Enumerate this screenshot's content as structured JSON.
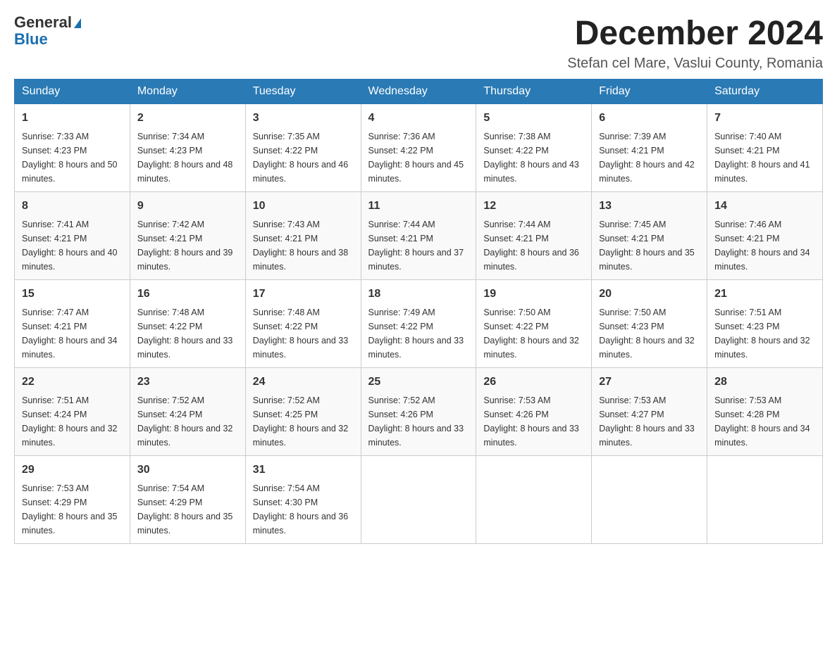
{
  "header": {
    "logo_general": "General",
    "logo_blue": "Blue",
    "month_year": "December 2024",
    "location": "Stefan cel Mare, Vaslui County, Romania"
  },
  "days_of_week": [
    "Sunday",
    "Monday",
    "Tuesday",
    "Wednesday",
    "Thursday",
    "Friday",
    "Saturday"
  ],
  "weeks": [
    [
      {
        "day": "1",
        "sunrise": "7:33 AM",
        "sunset": "4:23 PM",
        "daylight": "8 hours and 50 minutes."
      },
      {
        "day": "2",
        "sunrise": "7:34 AM",
        "sunset": "4:23 PM",
        "daylight": "8 hours and 48 minutes."
      },
      {
        "day": "3",
        "sunrise": "7:35 AM",
        "sunset": "4:22 PM",
        "daylight": "8 hours and 46 minutes."
      },
      {
        "day": "4",
        "sunrise": "7:36 AM",
        "sunset": "4:22 PM",
        "daylight": "8 hours and 45 minutes."
      },
      {
        "day": "5",
        "sunrise": "7:38 AM",
        "sunset": "4:22 PM",
        "daylight": "8 hours and 43 minutes."
      },
      {
        "day": "6",
        "sunrise": "7:39 AM",
        "sunset": "4:21 PM",
        "daylight": "8 hours and 42 minutes."
      },
      {
        "day": "7",
        "sunrise": "7:40 AM",
        "sunset": "4:21 PM",
        "daylight": "8 hours and 41 minutes."
      }
    ],
    [
      {
        "day": "8",
        "sunrise": "7:41 AM",
        "sunset": "4:21 PM",
        "daylight": "8 hours and 40 minutes."
      },
      {
        "day": "9",
        "sunrise": "7:42 AM",
        "sunset": "4:21 PM",
        "daylight": "8 hours and 39 minutes."
      },
      {
        "day": "10",
        "sunrise": "7:43 AM",
        "sunset": "4:21 PM",
        "daylight": "8 hours and 38 minutes."
      },
      {
        "day": "11",
        "sunrise": "7:44 AM",
        "sunset": "4:21 PM",
        "daylight": "8 hours and 37 minutes."
      },
      {
        "day": "12",
        "sunrise": "7:44 AM",
        "sunset": "4:21 PM",
        "daylight": "8 hours and 36 minutes."
      },
      {
        "day": "13",
        "sunrise": "7:45 AM",
        "sunset": "4:21 PM",
        "daylight": "8 hours and 35 minutes."
      },
      {
        "day": "14",
        "sunrise": "7:46 AM",
        "sunset": "4:21 PM",
        "daylight": "8 hours and 34 minutes."
      }
    ],
    [
      {
        "day": "15",
        "sunrise": "7:47 AM",
        "sunset": "4:21 PM",
        "daylight": "8 hours and 34 minutes."
      },
      {
        "day": "16",
        "sunrise": "7:48 AM",
        "sunset": "4:22 PM",
        "daylight": "8 hours and 33 minutes."
      },
      {
        "day": "17",
        "sunrise": "7:48 AM",
        "sunset": "4:22 PM",
        "daylight": "8 hours and 33 minutes."
      },
      {
        "day": "18",
        "sunrise": "7:49 AM",
        "sunset": "4:22 PM",
        "daylight": "8 hours and 33 minutes."
      },
      {
        "day": "19",
        "sunrise": "7:50 AM",
        "sunset": "4:22 PM",
        "daylight": "8 hours and 32 minutes."
      },
      {
        "day": "20",
        "sunrise": "7:50 AM",
        "sunset": "4:23 PM",
        "daylight": "8 hours and 32 minutes."
      },
      {
        "day": "21",
        "sunrise": "7:51 AM",
        "sunset": "4:23 PM",
        "daylight": "8 hours and 32 minutes."
      }
    ],
    [
      {
        "day": "22",
        "sunrise": "7:51 AM",
        "sunset": "4:24 PM",
        "daylight": "8 hours and 32 minutes."
      },
      {
        "day": "23",
        "sunrise": "7:52 AM",
        "sunset": "4:24 PM",
        "daylight": "8 hours and 32 minutes."
      },
      {
        "day": "24",
        "sunrise": "7:52 AM",
        "sunset": "4:25 PM",
        "daylight": "8 hours and 32 minutes."
      },
      {
        "day": "25",
        "sunrise": "7:52 AM",
        "sunset": "4:26 PM",
        "daylight": "8 hours and 33 minutes."
      },
      {
        "day": "26",
        "sunrise": "7:53 AM",
        "sunset": "4:26 PM",
        "daylight": "8 hours and 33 minutes."
      },
      {
        "day": "27",
        "sunrise": "7:53 AM",
        "sunset": "4:27 PM",
        "daylight": "8 hours and 33 minutes."
      },
      {
        "day": "28",
        "sunrise": "7:53 AM",
        "sunset": "4:28 PM",
        "daylight": "8 hours and 34 minutes."
      }
    ],
    [
      {
        "day": "29",
        "sunrise": "7:53 AM",
        "sunset": "4:29 PM",
        "daylight": "8 hours and 35 minutes."
      },
      {
        "day": "30",
        "sunrise": "7:54 AM",
        "sunset": "4:29 PM",
        "daylight": "8 hours and 35 minutes."
      },
      {
        "day": "31",
        "sunrise": "7:54 AM",
        "sunset": "4:30 PM",
        "daylight": "8 hours and 36 minutes."
      },
      null,
      null,
      null,
      null
    ]
  ]
}
